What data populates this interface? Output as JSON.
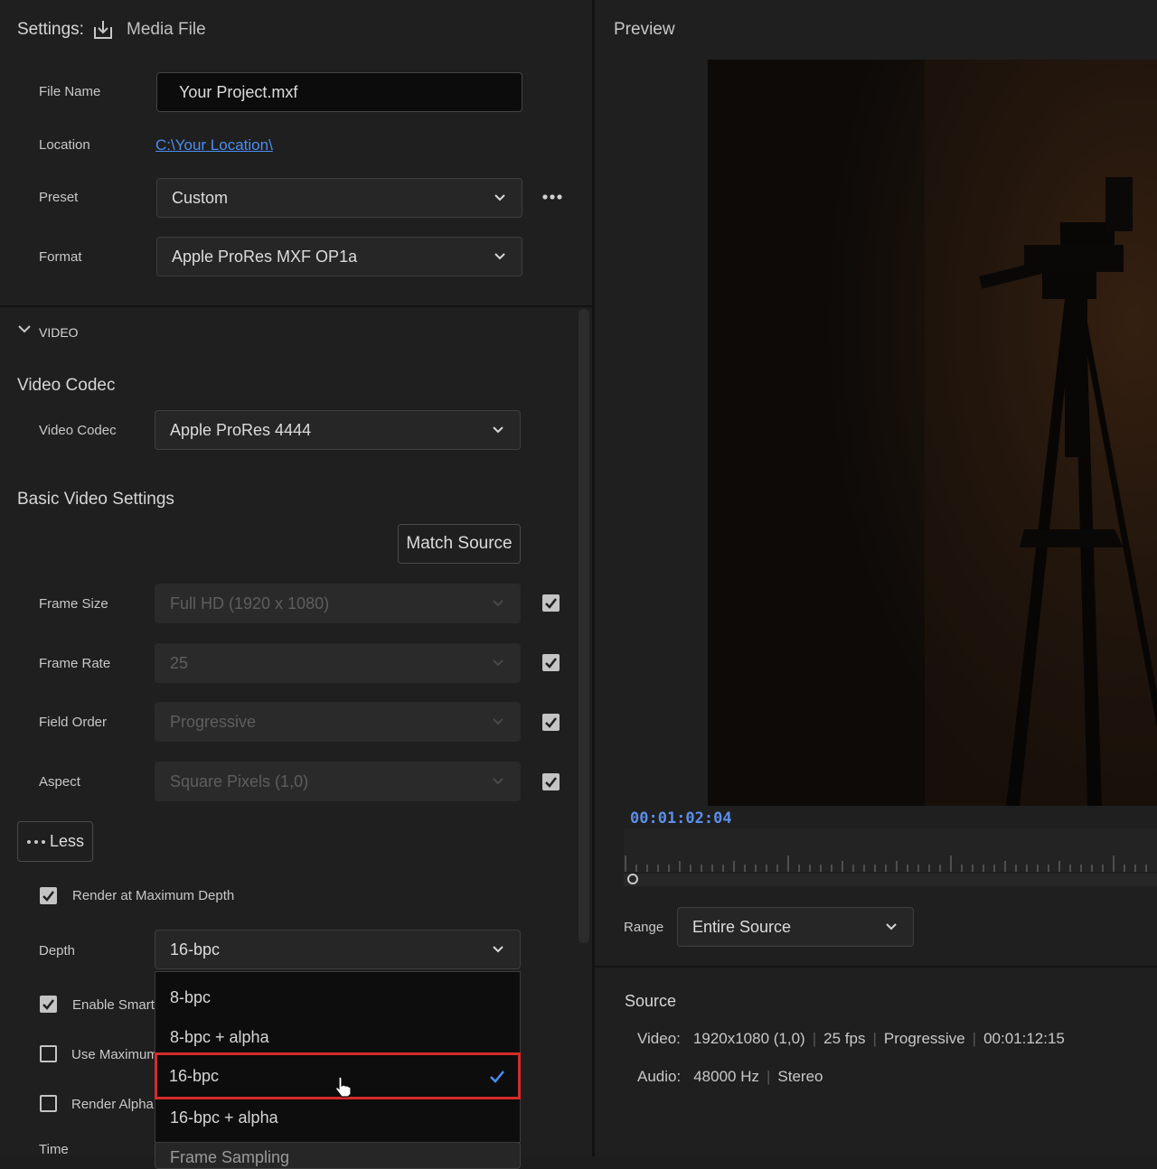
{
  "header": {
    "settings_label": "Settings:",
    "media_file_label": "Media File",
    "preview_label": "Preview"
  },
  "file_name": {
    "label": "File Name",
    "value": "Your Project.mxf"
  },
  "location": {
    "label": "Location",
    "value": "C:\\Your Location\\"
  },
  "preset": {
    "label": "Preset",
    "value": "Custom"
  },
  "format": {
    "label": "Format",
    "value": "Apple ProRes MXF OP1a"
  },
  "video_section": {
    "title": "VIDEO",
    "codec_heading": "Video Codec",
    "codec_label": "Video Codec",
    "codec_value": "Apple ProRes 4444",
    "basic_heading": "Basic Video Settings",
    "match_source": "Match Source",
    "frame_size": {
      "label": "Frame Size",
      "value": "Full HD (1920 x 1080)"
    },
    "frame_rate": {
      "label": "Frame Rate",
      "value": "25"
    },
    "field_order": {
      "label": "Field Order",
      "value": "Progressive"
    },
    "aspect": {
      "label": "Aspect",
      "value": "Square Pixels (1,0)"
    },
    "less_button": "Less",
    "render_max_depth": "Render at Maximum Depth",
    "depth_label": "Depth",
    "depth_value": "16-bpc",
    "enable_smart": "Enable Smart",
    "use_maximum": "Use Maximum",
    "render_alpha": "Render Alpha",
    "time_label": "Time",
    "time_value_partial": "Frame Sampling"
  },
  "depth_menu": {
    "options": [
      "8-bpc",
      "8-bpc + alpha",
      "16-bpc",
      "16-bpc + alpha"
    ],
    "selected": "16-bpc"
  },
  "preview": {
    "timecode": "00:01:02:04",
    "range_label": "Range",
    "range_value": "Entire Source"
  },
  "source": {
    "title": "Source",
    "video_label": "Video:",
    "video_res": "1920x1080 (1,0)",
    "video_fps": "25 fps",
    "video_scan": "Progressive",
    "video_duration": "00:01:12:15",
    "audio_label": "Audio:",
    "audio_rate": "48000 Hz",
    "audio_channels": "Stereo"
  },
  "colors": {
    "accent": "#4b8df0",
    "highlight": "#d52b2b",
    "timecode": "#5b8fe8"
  }
}
